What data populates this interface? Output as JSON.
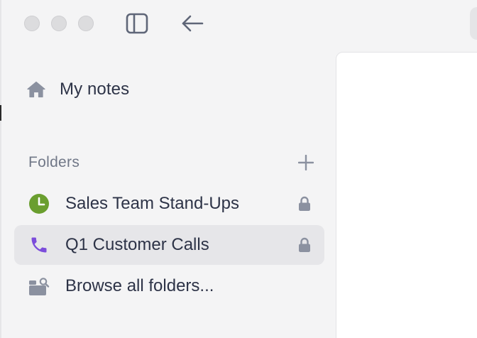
{
  "window": {
    "controls": [
      "close",
      "minimize",
      "zoom"
    ]
  },
  "toolbar": {
    "sidebar_toggle_icon": "sidebar-icon",
    "back_icon": "arrow-left-icon"
  },
  "sidebar": {
    "home": {
      "label": "My notes",
      "icon": "home-icon"
    },
    "folders": {
      "title": "Folders",
      "add_icon": "plus-icon",
      "items": [
        {
          "label": "Sales Team Stand-Ups",
          "icon": "clock-icon",
          "icon_color": "#6a9e2f",
          "locked": true,
          "active": false
        },
        {
          "label": "Q1 Customer Calls",
          "icon": "phone-icon",
          "icon_color": "#7c4ddb",
          "locked": true,
          "active": true
        },
        {
          "label": "Browse all folders...",
          "icon": "browse-folders-icon",
          "locked": false,
          "active": false
        }
      ]
    }
  },
  "colors": {
    "sidebar_bg": "#f4f4f5",
    "active_row_bg": "#e6e6e9",
    "text_primary": "#2d3347",
    "text_muted": "#707787",
    "icon_gray": "#8b91a0"
  }
}
